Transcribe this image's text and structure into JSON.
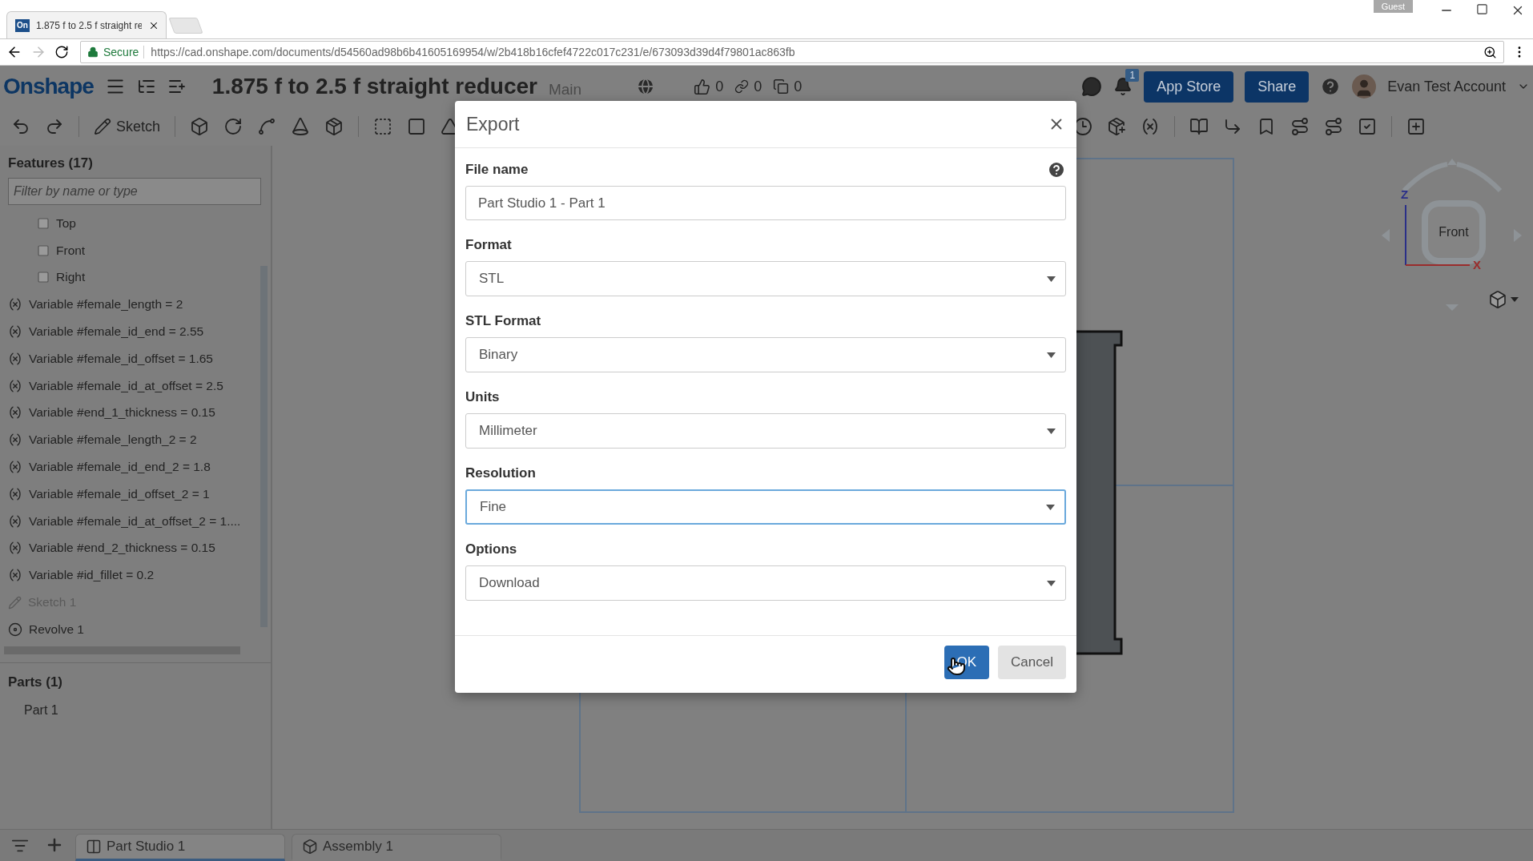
{
  "browser": {
    "tab": {
      "favicon": "On",
      "title": "1.875 f to 2.5 f straight re"
    },
    "profile": "Guest",
    "address": {
      "secure_label": "Secure",
      "url": "https://cad.onshape.com/documents/d54560ad98b6b41605169954/w/2b418b16cfef4722c017c231/e/673093d39d4f79801ac863fb"
    }
  },
  "header": {
    "logo": "Onshape",
    "title": "1.875 f to 2.5 f straight reducer",
    "branch": "Main",
    "counts": [
      {
        "kind": "like",
        "value": "0"
      },
      {
        "kind": "link",
        "value": "0"
      },
      {
        "kind": "copy",
        "value": "0"
      }
    ],
    "notifications": "1",
    "buttons": [
      "App Store",
      "Share"
    ],
    "user": "Evan Test Account"
  },
  "toolbar": {
    "sketch": "Sketch"
  },
  "features": {
    "title": "Features (17)",
    "filter_placeholder": "Filter by name or type",
    "items": [
      {
        "kind": "plane",
        "label": "Top",
        "disabled": false
      },
      {
        "kind": "plane",
        "label": "Front",
        "disabled": false
      },
      {
        "kind": "plane",
        "label": "Right",
        "disabled": false
      },
      {
        "kind": "variable",
        "label": "Variable #female_length = 2",
        "disabled": false
      },
      {
        "kind": "variable",
        "label": "Variable #female_id_end = 2.55",
        "disabled": false
      },
      {
        "kind": "variable",
        "label": "Variable #female_id_offset = 1.65",
        "disabled": false
      },
      {
        "kind": "variable",
        "label": "Variable #female_id_at_offset = 2.5",
        "disabled": false
      },
      {
        "kind": "variable",
        "label": "Variable #end_1_thickness = 0.15",
        "disabled": false
      },
      {
        "kind": "variable",
        "label": "Variable #female_length_2 = 2",
        "disabled": false
      },
      {
        "kind": "variable",
        "label": "Variable #female_id_end_2 = 1.8",
        "disabled": false
      },
      {
        "kind": "variable",
        "label": "Variable #female_id_offset_2 = 1",
        "disabled": false
      },
      {
        "kind": "variable",
        "label": "Variable #female_id_at_offset_2 = 1....",
        "disabled": false
      },
      {
        "kind": "variable",
        "label": "Variable #end_2_thickness = 0.15",
        "disabled": false
      },
      {
        "kind": "variable",
        "label": "Variable #id_fillet = 0.2",
        "disabled": false
      },
      {
        "kind": "sketch",
        "label": "Sketch 1",
        "disabled": true
      },
      {
        "kind": "revolve",
        "label": "Revolve 1",
        "disabled": false
      }
    ]
  },
  "parts": {
    "title": "Parts (1)",
    "items": [
      "Part 1"
    ]
  },
  "viewport": {
    "view_cube": {
      "face": "Front",
      "axes": [
        "Z",
        "X"
      ]
    }
  },
  "tabs": [
    {
      "kind": "part_studio",
      "label": "Part Studio 1",
      "selected": true
    },
    {
      "kind": "assembly",
      "label": "Assembly 1",
      "selected": false
    }
  ],
  "dialog": {
    "title": "Export",
    "fields": [
      {
        "kind": "text",
        "label": "File name",
        "value": "Part Studio 1 - Part 1",
        "focused": false
      },
      {
        "kind": "select",
        "label": "Format",
        "value": "STL",
        "focused": false
      },
      {
        "kind": "select",
        "label": "STL Format",
        "value": "Binary",
        "focused": false
      },
      {
        "kind": "select",
        "label": "Units",
        "value": "Millimeter",
        "focused": false
      },
      {
        "kind": "select",
        "label": "Resolution",
        "value": "Fine",
        "focused": true
      },
      {
        "kind": "select",
        "label": "Options",
        "value": "Download",
        "focused": false
      }
    ],
    "buttons": [
      {
        "kind": "primary",
        "label": "OK"
      },
      {
        "kind": "secondary",
        "label": "Cancel"
      }
    ]
  }
}
